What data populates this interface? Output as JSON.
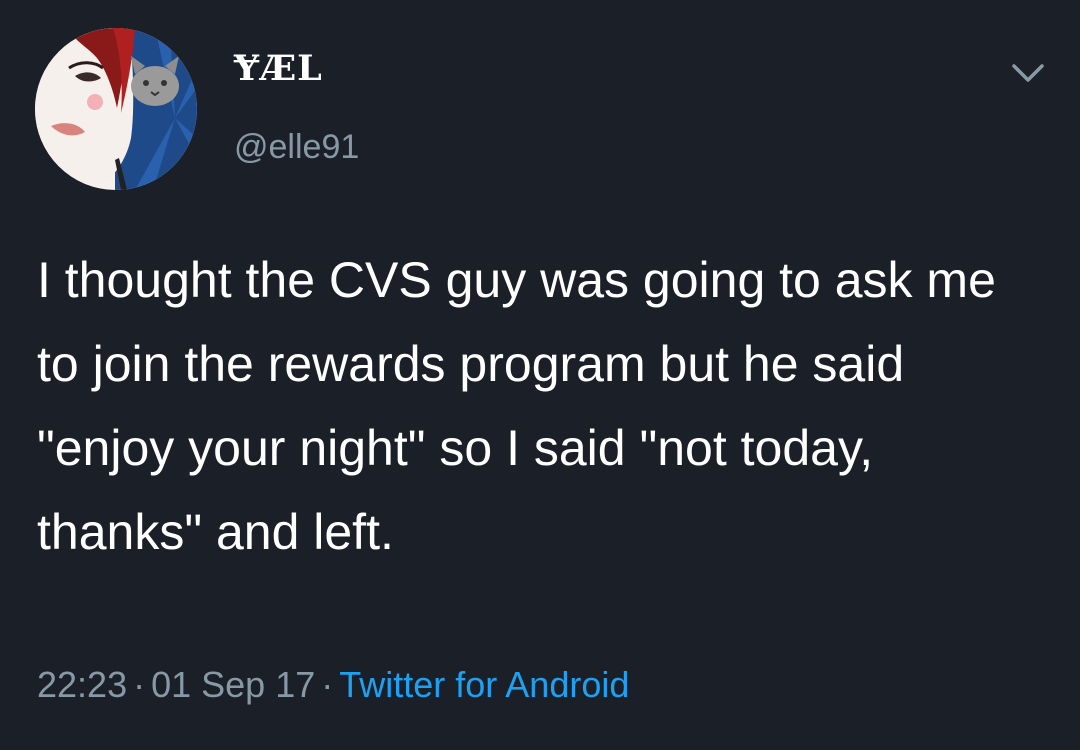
{
  "tweet": {
    "display_name": "ɎÆL",
    "handle": "@elle91",
    "text": "I thought the CVS guy was going to ask me to join the rewards program but he said \"enjoy your night\" so I said \"not today, thanks\" and left.",
    "time": "22:23",
    "date": "01 Sep 17",
    "separator": "·",
    "source": "Twitter for Android"
  },
  "icons": {
    "menu": "chevron-down-icon",
    "avatar": "profile-avatar"
  },
  "colors": {
    "background": "#1b2028",
    "text": "#ffffff",
    "muted": "#8899a6",
    "link": "#1da1f2"
  }
}
